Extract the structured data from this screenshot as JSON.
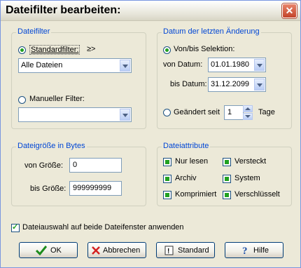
{
  "window": {
    "title": "Dateifilter bearbeiten:",
    "close_symbol": "✕"
  },
  "dateifilter": {
    "legend": "Dateifilter",
    "standard_label": "Standardfilter:",
    "standard_arrow": "≥>",
    "standard_value": "Alle Dateien",
    "manual_label": "Manueller Filter:",
    "manual_value": ""
  },
  "datum": {
    "legend": "Datum der letzten Änderung",
    "vonbis_label": "Von/bis Selektion:",
    "von_label": "von Datum:",
    "von_value": "01.01.1980",
    "bis_label": "bis Datum:",
    "bis_value": "31.12.2099",
    "geaendert_label": "Geändert seit",
    "geaendert_value": "1",
    "tage_label": "Tage"
  },
  "groesse": {
    "legend": "Dateigröße in Bytes",
    "von_label": "von Größe:",
    "von_value": "0",
    "bis_label": "bis Größe:",
    "bis_value": "999999999"
  },
  "attribute": {
    "legend": "Dateiattribute",
    "nur_lesen": "Nur lesen",
    "versteckt": "Versteckt",
    "archiv": "Archiv",
    "system": "System",
    "komprimiert": "Komprimiert",
    "verschluesselt": "Verschlüsselt"
  },
  "both_windows_label": "Dateiauswahl auf beide Dateifenster anwenden",
  "buttons": {
    "ok": "OK",
    "abbrechen": "Abbrechen",
    "standard": "Standard",
    "hilfe": "Hilfe"
  },
  "colors": {
    "accent_green": "#21a121",
    "legend_blue": "#0046d5",
    "cancel_red": "#d42020"
  }
}
